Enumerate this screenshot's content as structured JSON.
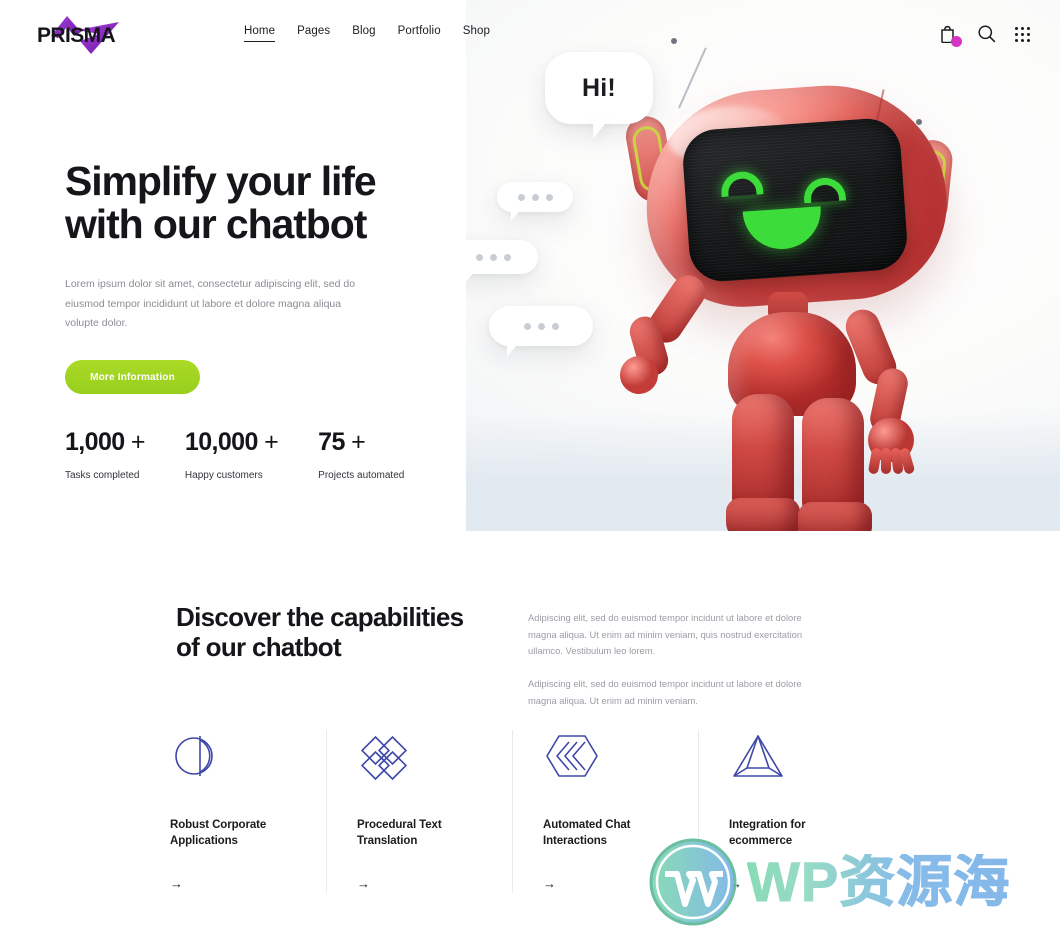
{
  "brand": {
    "name": "PRISMA",
    "logo_icon": "prisma-arrow-logo",
    "accent_purple": "#8b2fc9"
  },
  "header": {
    "nav": [
      {
        "label": "Home",
        "active": true
      },
      {
        "label": "Pages",
        "active": false
      },
      {
        "label": "Blog",
        "active": false
      },
      {
        "label": "Portfolio",
        "active": false
      },
      {
        "label": "Shop",
        "active": false
      }
    ],
    "icons": [
      {
        "name": "shopping-bag-icon",
        "badge": ""
      },
      {
        "name": "search-icon"
      },
      {
        "name": "grid-menu-icon"
      }
    ],
    "badge_color": "#d634c6"
  },
  "hero": {
    "title_line1": "Simplify your life",
    "title_line2": "with our chatbot",
    "subtitle": "Lorem ipsum dolor sit amet, consectetur adipiscing elit, sed do eiusmod tempor incididunt ut labore et dolore magna aliqua volupte dolor.",
    "cta_label": "More Information",
    "cta_color": "#a2d41f",
    "bubbles": {
      "greeting": "Hi!"
    },
    "stats": [
      {
        "value": "1,000",
        "plus": "+",
        "label": "Tasks completed"
      },
      {
        "value": "10,000",
        "plus": "+",
        "label": "Happy customers"
      },
      {
        "value": "75",
        "plus": "+",
        "label": "Projects automated"
      }
    ]
  },
  "capabilities": {
    "title_line1": "Discover the capabilities",
    "title_line2": "of our chatbot",
    "paragraph1": "Adipiscing elit, sed do euismod tempor incidunt ut labore et dolore magna aliqua. Ut enim ad minim veniam, quis nostrud exercitation ullamco. Vestibulum leo lorem.",
    "paragraph2": "Adipiscing elit, sed do euismod tempor incidunt ut labore et dolore magna aliqua. Ut enim ad minim veniam."
  },
  "features": [
    {
      "icon": "circle-split-icon",
      "title_line1": "Robust Corporate",
      "title_line2": "Applications",
      "arrow": "→"
    },
    {
      "icon": "four-diamonds-icon",
      "title_line1": "Procedural Text",
      "title_line2": "Translation",
      "arrow": "→"
    },
    {
      "icon": "hexagon-chevrons-icon",
      "title_line1": "Automated Chat",
      "title_line2": "Interactions",
      "arrow": "→"
    },
    {
      "icon": "nested-triangle-icon",
      "title_line1": "Integration for",
      "title_line2": "ecommerce",
      "arrow": "→"
    }
  ],
  "feature_icon_color": "#3f48a8",
  "watermark": {
    "text": "WP资源海",
    "logo_icon": "wordpress-logo"
  }
}
